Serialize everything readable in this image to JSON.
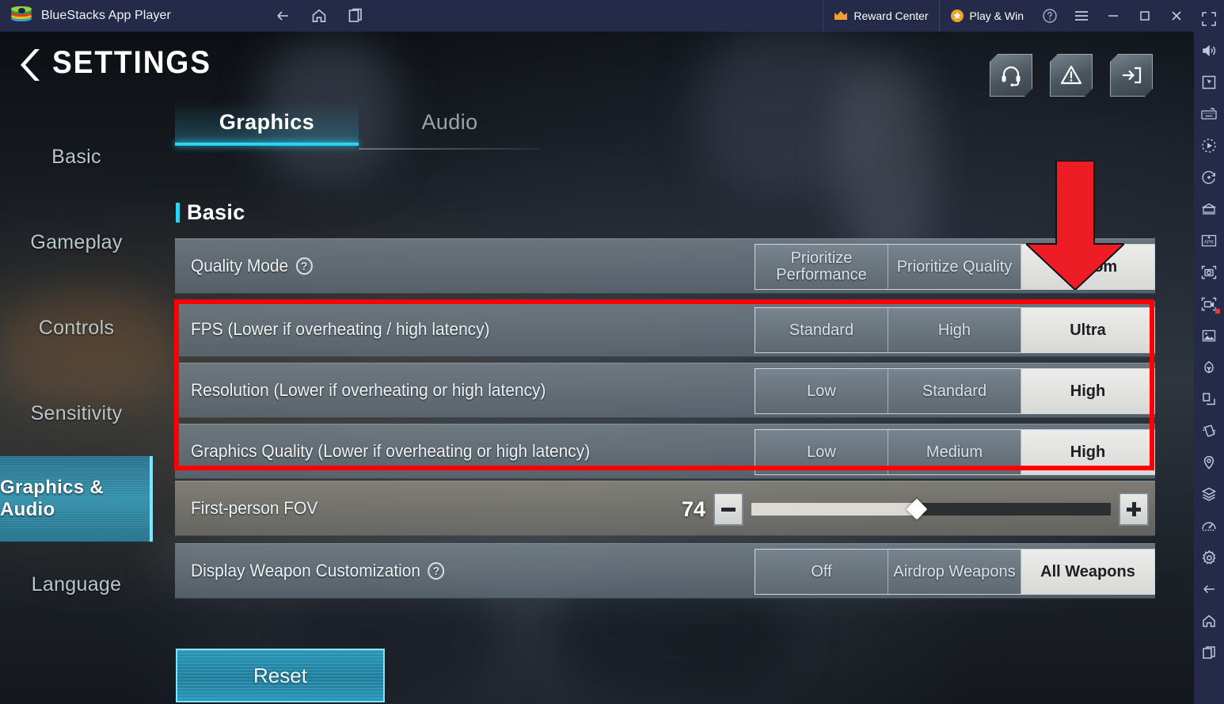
{
  "titlebar": {
    "app_name": "BlueStacks App Player",
    "nav": [
      {
        "name": "back-icon",
        "label": "Back"
      },
      {
        "name": "home-icon",
        "label": "Home"
      },
      {
        "name": "multi-instance-icon",
        "label": "Multi-instance"
      }
    ],
    "reward_center": "Reward Center",
    "play_and_win": "Play & Win",
    "help_label": "Help",
    "menu_label": "Menu",
    "minimize_label": "Minimize",
    "maximize_label": "Maximize",
    "close_label": "Close",
    "collapse_label": "Collapse"
  },
  "settings": {
    "title": "SETTINGS",
    "header_icons": [
      {
        "name": "support-headset-icon",
        "label": "Customer Service"
      },
      {
        "name": "warning-report-icon",
        "label": "Report"
      },
      {
        "name": "logout-icon",
        "label": "Exit"
      }
    ],
    "nav_items": [
      {
        "label": "Basic",
        "active": false
      },
      {
        "label": "Gameplay",
        "active": false
      },
      {
        "label": "Controls",
        "active": false
      },
      {
        "label": "Sensitivity",
        "active": false
      },
      {
        "label": "Graphics & Audio",
        "active": true
      },
      {
        "label": "Language",
        "active": false
      }
    ],
    "tabs": [
      {
        "label": "Graphics",
        "active": true
      },
      {
        "label": "Audio",
        "active": false
      }
    ],
    "section_title": "Basic",
    "rows": [
      {
        "label": "Quality Mode",
        "has_help": true,
        "type": "segmented",
        "options": [
          "Prioritize Performance",
          "Prioritize Quality",
          "Custom"
        ],
        "selected": "Custom"
      },
      {
        "label": "FPS (Lower if overheating / high latency)",
        "has_help": false,
        "type": "segmented",
        "options": [
          "Standard",
          "High",
          "Ultra"
        ],
        "selected": "Ultra"
      },
      {
        "label": "Resolution (Lower if overheating or high latency)",
        "has_help": false,
        "type": "segmented",
        "options": [
          "Low",
          "Standard",
          "High"
        ],
        "selected": "High"
      },
      {
        "label": "Graphics Quality (Lower if overheating or high latency)",
        "has_help": false,
        "type": "segmented",
        "options": [
          "Low",
          "Medium",
          "High"
        ],
        "selected": "High"
      },
      {
        "label": "First-person FOV",
        "has_help": false,
        "type": "slider",
        "value": "74",
        "fill_percent": 46,
        "decrement_label": "-",
        "increment_label": "+"
      },
      {
        "label": "Display Weapon Customization",
        "has_help": true,
        "type": "segmented",
        "options": [
          "Off",
          "Airdrop Weapons",
          "All Weapons"
        ],
        "selected": "All Weapons"
      }
    ],
    "reset_label": "Reset"
  },
  "annotations": {
    "highlight_color": "#ff0000",
    "arrow_color": "#ff0000",
    "arrow_points_to": "Custom",
    "box_surrounds": "FPS / Resolution / Graphics Quality rows"
  },
  "rightbar": {
    "items": [
      {
        "name": "fullscreen-icon",
        "label": "Full screen"
      },
      {
        "name": "volume-icon",
        "label": "Volume"
      },
      {
        "name": "cursor-icon",
        "label": "Game controls"
      },
      {
        "name": "keyboard-icon",
        "label": "Keyboard controls"
      },
      {
        "name": "macro-record-icon",
        "label": "Macro recorder"
      },
      {
        "name": "rotate-icon",
        "label": "Rotate"
      },
      {
        "name": "multi-instance-manager-icon",
        "label": "Multi-instance manager"
      },
      {
        "name": "install-apk-icon",
        "label": "Install APK"
      },
      {
        "name": "screenshot-icon",
        "label": "Screenshot"
      },
      {
        "name": "screen-record-icon",
        "label": "Screen record"
      },
      {
        "name": "media-manager-icon",
        "label": "Media manager"
      },
      {
        "name": "eco-mode-icon",
        "label": "Eco mode"
      },
      {
        "name": "copy-paste-icon",
        "label": "Copy-paste"
      },
      {
        "name": "shake-icon",
        "label": "Shake"
      },
      {
        "name": "location-icon",
        "label": "Location"
      },
      {
        "name": "layers-icon",
        "label": "Layers"
      },
      {
        "name": "performance-icon",
        "label": "Performance"
      },
      {
        "name": "settings-gear-icon",
        "label": "Settings"
      },
      {
        "name": "back-icon",
        "label": "Back"
      },
      {
        "name": "home-icon",
        "label": "Home"
      },
      {
        "name": "recents-icon",
        "label": "Recent apps"
      }
    ]
  }
}
